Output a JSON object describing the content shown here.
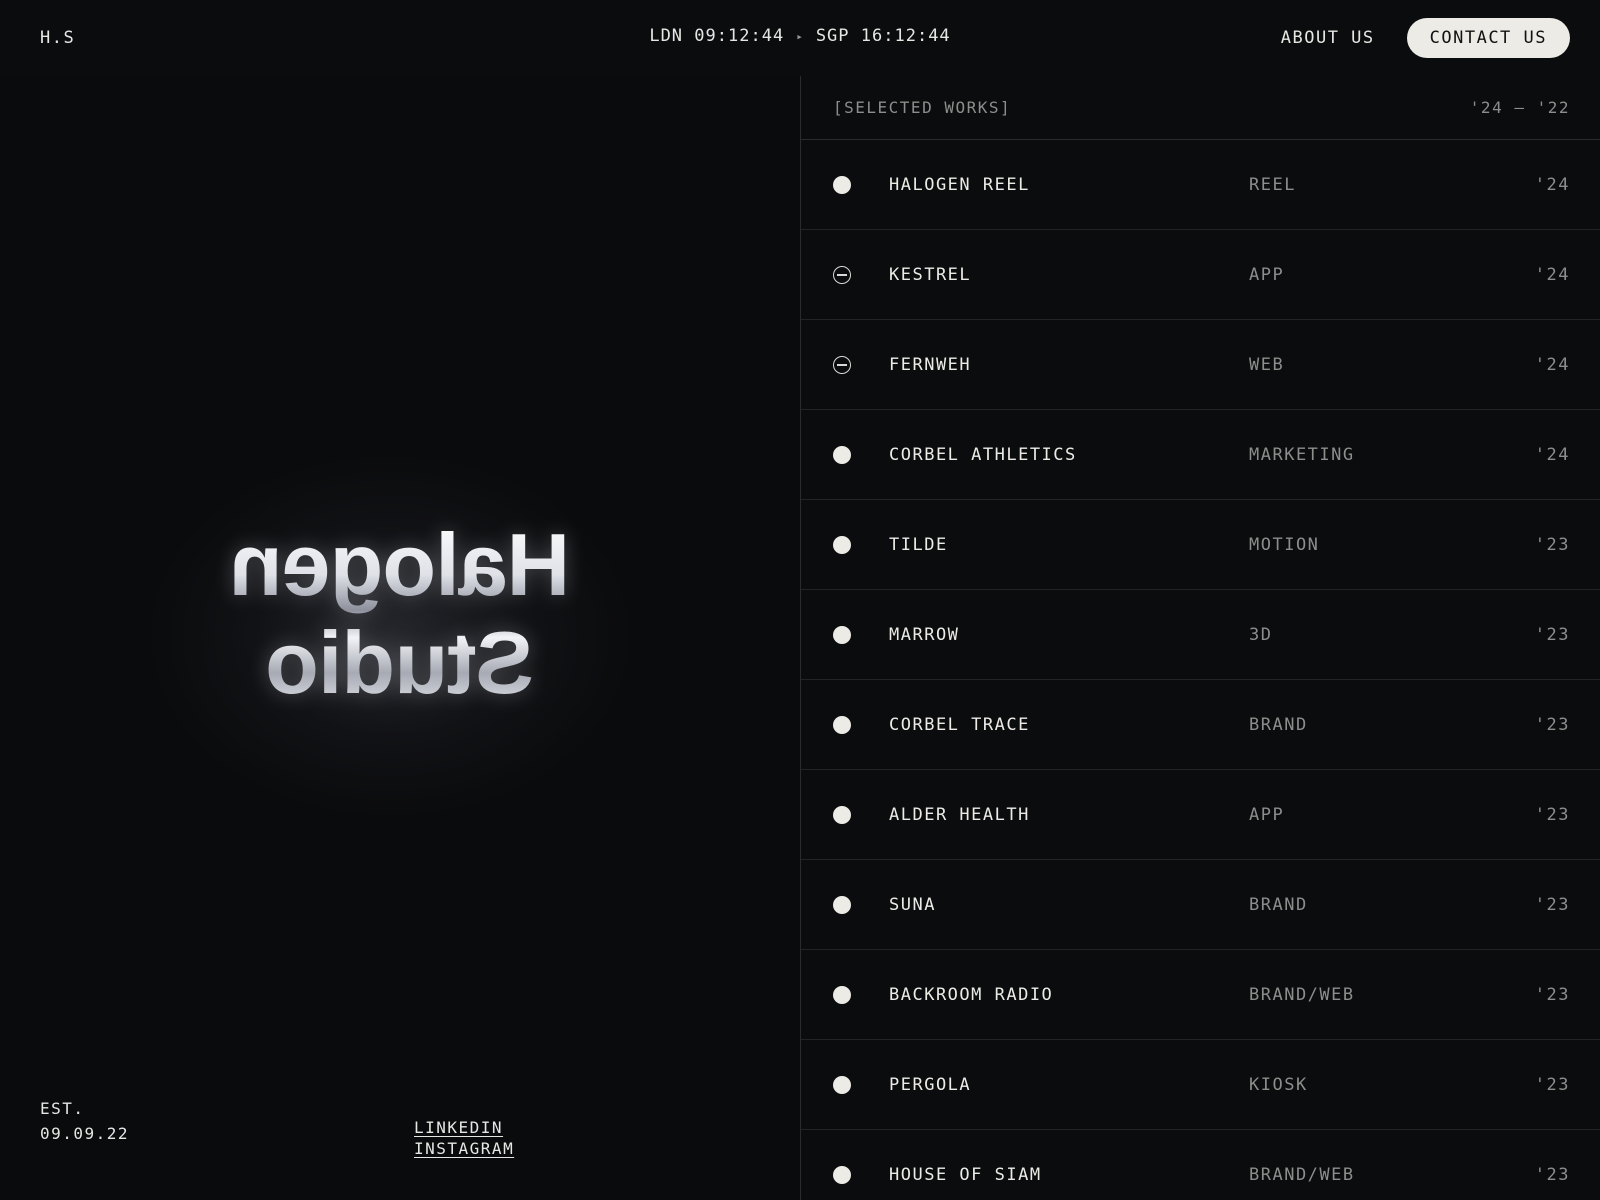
{
  "header": {
    "logo": "H.S",
    "clock": {
      "city1": "LDN",
      "time1": "09:12:44",
      "separator": "▸",
      "city2": "SGP",
      "time2": "16:12:44"
    },
    "about_label": "ABOUT US",
    "contact_label": "CONTACT US"
  },
  "hero": {
    "title_line1": "Halogen",
    "title_line2": "Studio",
    "est_label": "EST.",
    "est_date": "09.09.22",
    "social": [
      "LINKEDIN",
      "INSTAGRAM"
    ]
  },
  "works": {
    "label": "[SELECTED WORKS]",
    "range": "'24 — '22",
    "items": [
      {
        "name": "HALOGEN REEL",
        "category": "REEL",
        "year": "'24",
        "icon": "filled-dot-icon"
      },
      {
        "name": "KESTREL",
        "category": "APP",
        "year": "'24",
        "icon": "minus-circle-icon"
      },
      {
        "name": "FERNWEH",
        "category": "WEB",
        "year": "'24",
        "icon": "minus-circle-icon"
      },
      {
        "name": "CORBEL ATHLETICS",
        "category": "MARKETING",
        "year": "'24",
        "icon": "filled-dot-icon"
      },
      {
        "name": "TILDE",
        "category": "MOTION",
        "year": "'23",
        "icon": "filled-dot-icon"
      },
      {
        "name": "MARROW",
        "category": "3D",
        "year": "'23",
        "icon": "filled-dot-icon"
      },
      {
        "name": "CORBEL TRACE",
        "category": "BRAND",
        "year": "'23",
        "icon": "filled-dot-icon"
      },
      {
        "name": "ALDER HEALTH",
        "category": "APP",
        "year": "'23",
        "icon": "filled-dot-icon"
      },
      {
        "name": "SUNA",
        "category": "BRAND",
        "year": "'23",
        "icon": "filled-dot-icon"
      },
      {
        "name": "BACKROOM RADIO",
        "category": "BRAND/WEB",
        "year": "'23",
        "icon": "filled-dot-icon"
      },
      {
        "name": "PERGOLA",
        "category": "KIOSK",
        "year": "'23",
        "icon": "filled-dot-icon"
      },
      {
        "name": "HOUSE OF SIAM",
        "category": "BRAND/WEB",
        "year": "'23",
        "icon": "filled-dot-icon"
      }
    ]
  },
  "colors": {
    "background": "#0b0c0e",
    "text": "#e6e6e3",
    "muted": "#8d8d8b",
    "button_bg": "#ecebe6",
    "divider": "#2a2b2e"
  }
}
